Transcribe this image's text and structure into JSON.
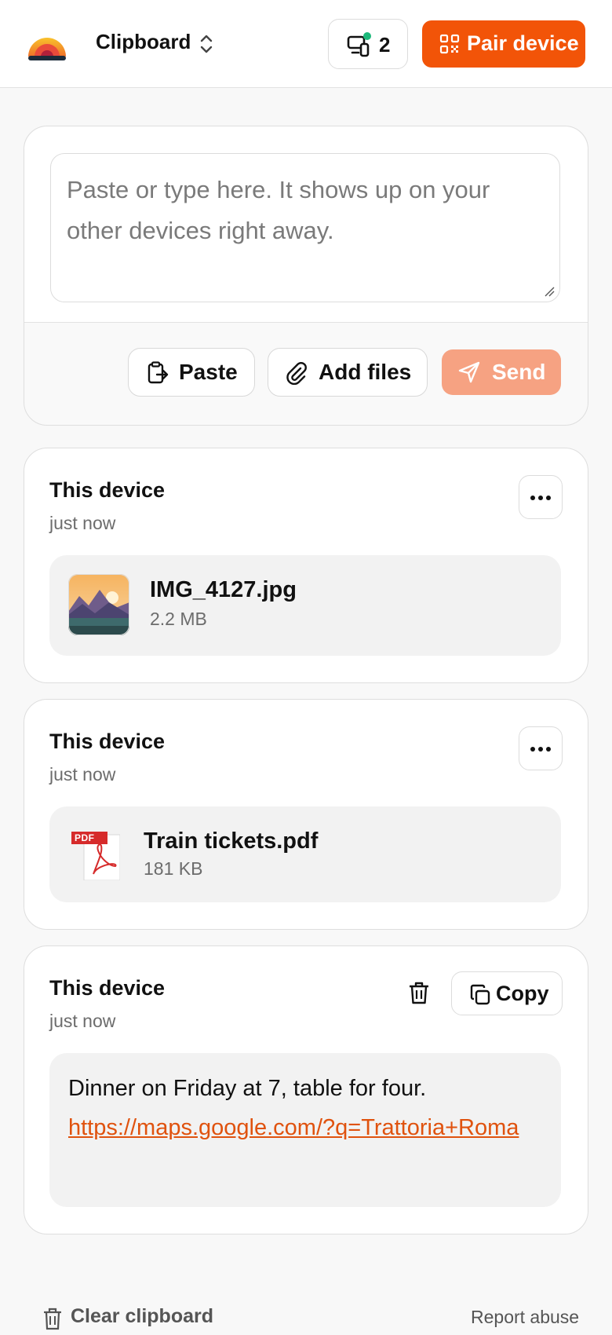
{
  "header": {
    "title": "Clipboard",
    "connected_devices_count": "2",
    "pair_device_label": "Pair device"
  },
  "composer": {
    "placeholder": "Paste or type here. It shows up on your other devices right away.",
    "paste_label": "Paste",
    "add_files_label": "Add files",
    "send_label": "Send"
  },
  "entries": [
    {
      "source": "This device",
      "time": "just now",
      "file_name": "IMG_4127.jpg",
      "file_size": "2.2 MB",
      "file_type": "image-thumbnail"
    },
    {
      "source": "This device",
      "time": "just now",
      "file_name": "Train tickets.pdf",
      "file_size": "181 KB",
      "file_type": "pdf-icon",
      "pdf_badge": "PDF"
    },
    {
      "source": "This device",
      "time": "just now",
      "text": "Dinner on Friday at 7, table for four.",
      "link": "https://maps.google.com/?q=Trattoria+Roma",
      "copy_label": "Copy"
    }
  ],
  "footer": {
    "clear_label": "Clear clipboard",
    "report_label": "Report abuse"
  },
  "colors": {
    "accent": "#f25408",
    "send_disabled": "#f6a282",
    "online": "#1cb87a"
  }
}
